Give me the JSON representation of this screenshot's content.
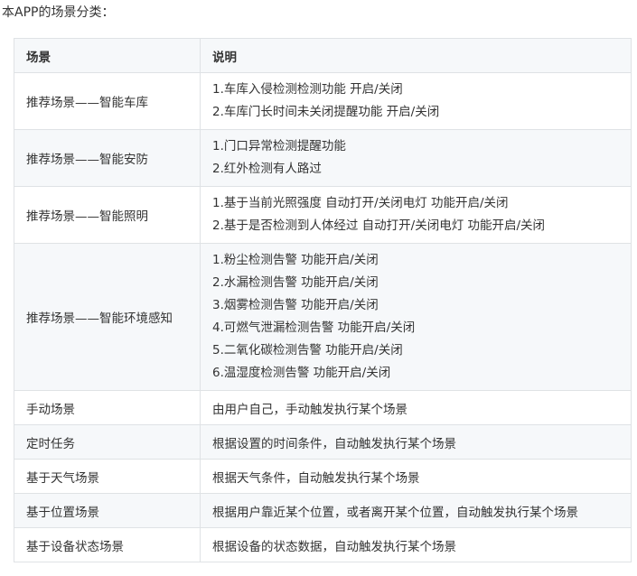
{
  "intro": "本APP的场景分类：",
  "table": {
    "headers": [
      "场景",
      "说明"
    ],
    "rows": [
      {
        "scene": "推荐场景——智能车库",
        "desc": [
          "1.车库入侵检测检测功能 开启/关闭",
          "2.车库门长时间未关闭提醒功能 开启/关闭"
        ]
      },
      {
        "scene": "推荐场景——智能安防",
        "desc": [
          "1.门口异常检测提醒功能",
          "2.红外检测有人路过"
        ]
      },
      {
        "scene": "推荐场景——智能照明",
        "desc": [
          "1.基于当前光照强度 自动打开/关闭电灯 功能开启/关闭",
          "2.基于是否检测到人体经过 自动打开/关闭电灯 功能开启/关闭"
        ]
      },
      {
        "scene": "推荐场景——智能环境感知",
        "desc": [
          "1.粉尘检测告警 功能开启/关闭",
          "2.水漏检测告警 功能开启/关闭",
          "3.烟雾检测告警 功能开启/关闭",
          "4.可燃气泄漏检测告警 功能开启/关闭",
          "5.二氧化碳检测告警 功能开启/关闭",
          "6.温湿度检测告警 功能开启/关闭"
        ]
      },
      {
        "scene": "手动场景",
        "desc": [
          "由用户自己，手动触发执行某个场景"
        ]
      },
      {
        "scene": "定时任务",
        "desc": [
          "根据设置的时间条件，自动触发执行某个场景"
        ]
      },
      {
        "scene": "基于天气场景",
        "desc": [
          "根据天气条件，自动触发执行某个场景"
        ]
      },
      {
        "scene": "基于位置场景",
        "desc": [
          "根据用户靠近某个位置，或者离开某个位置，自动触发执行某个场景"
        ]
      },
      {
        "scene": "基于设备状态场景",
        "desc": [
          "根据设备的状态数据，自动触发执行某个场景"
        ]
      }
    ]
  }
}
